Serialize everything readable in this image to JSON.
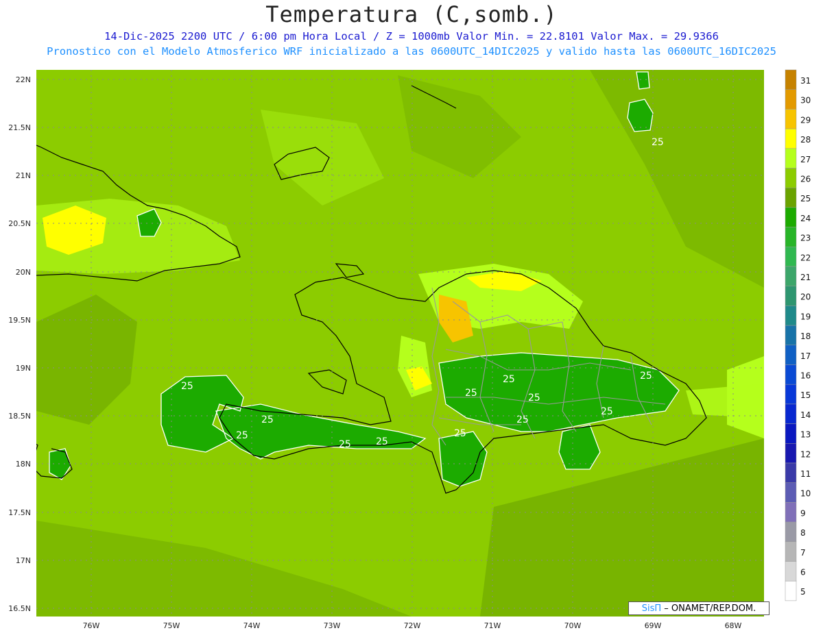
{
  "title": "Temperatura (C,somb.)",
  "subtitle1": "14-Dic-2025  2200 UTC / 6:00 pm Hora Local / Z = 1000mb   Valor Min. = 22.8101  Valor Max. = 29.9366",
  "subtitle2": "Pronostico con el Modelo Atmosferico WRF inicializado a las 0600UTC_14DIC2025 y valido hasta las  0600UTC_16DIC2025",
  "lat_labels": [
    "22N",
    "21.5N",
    "21N",
    "20.5N",
    "20N",
    "19.5N",
    "19N",
    "18.5N",
    "18N",
    "17.5N",
    "17N",
    "16.5N"
  ],
  "lon_labels": [
    "76W",
    "75W",
    "74W",
    "73W",
    "72W",
    "71W",
    "70W",
    "69W",
    "68W"
  ],
  "colorbar": {
    "labels": [
      "31",
      "30",
      "29",
      "28",
      "27",
      "26",
      "25",
      "24",
      "23",
      "22",
      "21",
      "20",
      "19",
      "18",
      "17",
      "16",
      "15",
      "14",
      "13",
      "12",
      "11",
      "10",
      "9",
      "8",
      "7",
      "6",
      "5"
    ],
    "colors": [
      "#c68200",
      "#e39a00",
      "#f7c400",
      "#ffff00",
      "#b5ff1c",
      "#8ccc00",
      "#6aa300",
      "#1cab00",
      "#28b528",
      "#30b850",
      "#3ca66a",
      "#2e9670",
      "#1f8a8a",
      "#1873a8",
      "#1060c4",
      "#0a4ad4",
      "#0838d8",
      "#0828d0",
      "#0a18c0",
      "#1818b0",
      "#3a3aa8",
      "#5c5cb4",
      "#8070b8",
      "#9a9aa6",
      "#b6b6b6",
      "#d8d8d8",
      "#ffffff"
    ]
  },
  "contour_labels": [
    "25",
    "25",
    "25",
    "25",
    "25",
    "25",
    "25",
    "25",
    "25",
    "25",
    "25",
    "25"
  ],
  "credit": {
    "brand": "SisΠ",
    "text": " – ONAMET/REP.DOM."
  }
}
